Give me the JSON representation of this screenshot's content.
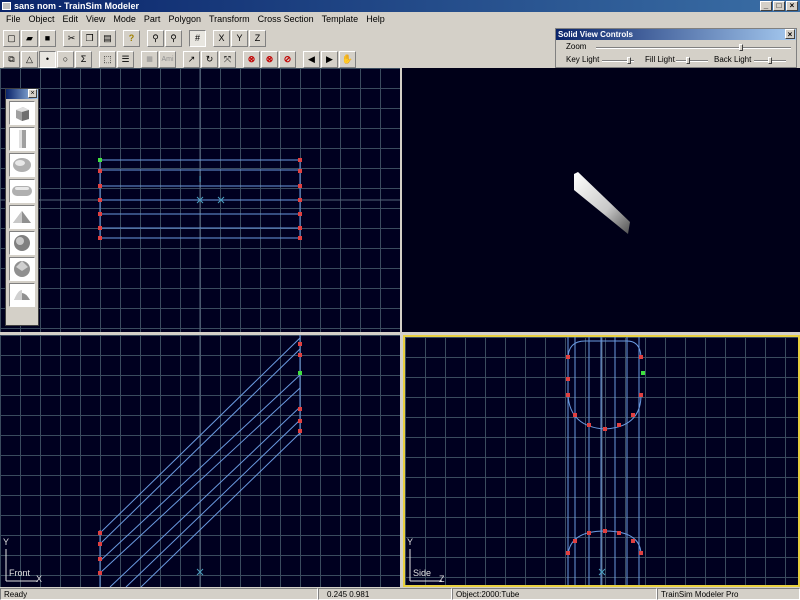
{
  "window": {
    "title": "sans nom - TrainSim Modeler",
    "min": "_",
    "max": "□",
    "close": "×"
  },
  "menu": [
    "File",
    "Object",
    "Edit",
    "View",
    "Mode",
    "Part",
    "Polygon",
    "Transform",
    "Cross Section",
    "Template",
    "Help"
  ],
  "toolbar": {
    "ami_label": "Ami",
    "x_label": "X",
    "y_label": "Y",
    "z_label": "Z"
  },
  "solid_view": {
    "title": "Solid View Controls",
    "close": "×",
    "zoom": "Zoom",
    "zoom_level": 0.75,
    "key_light": "Key Light",
    "key_light_level": 0.9,
    "fill_light": "Fill Light",
    "fill_light_level": 0.35,
    "back_light": "Back Light",
    "back_light_level": 0.5
  },
  "palette": {
    "close": "×",
    "shapes": [
      "box-icon",
      "cylinder-icon",
      "ellipse-icon",
      "tube-icon",
      "pyramid-icon",
      "sphere-icon",
      "geosphere-icon",
      "cone-icon"
    ]
  },
  "views": {
    "front": {
      "v": "Y",
      "h": "X",
      "name": "Front"
    },
    "side": {
      "v": "Y",
      "h": "Z",
      "name": "Side"
    }
  },
  "status": {
    "ready": "Ready",
    "coords": "0.245   0.981",
    "object": "Object:2000:Tube",
    "product": "TrainSim Modeler Pro"
  },
  "colors": {
    "viewport_bg": "#000020",
    "grid": "#3a4b5e",
    "wire": "#6a9ae0",
    "vertex": "#e04040",
    "selected_vertex": "#40e040",
    "active_border": "#e8d040"
  }
}
